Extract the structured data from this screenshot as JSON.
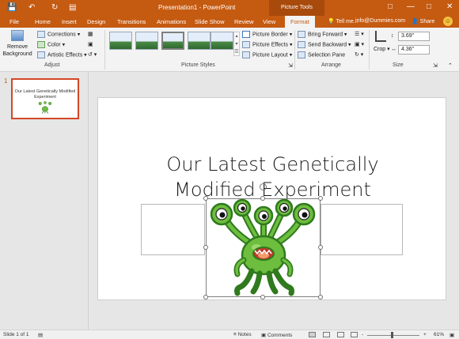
{
  "titlebar": {
    "window_title": "Presentation1 - PowerPoint",
    "context_tab_group": "Picture Tools",
    "quick_access": [
      "save-icon",
      "undo-icon",
      "redo-icon",
      "start-slideshow-icon"
    ],
    "window_controls": [
      "ribbon-display-options-icon",
      "minimize-icon",
      "maximize-icon",
      "close-icon"
    ]
  },
  "tabs": [
    "File",
    "Home",
    "Insert",
    "Design",
    "Transitions",
    "Animations",
    "Slide Show",
    "Review",
    "View",
    "Format"
  ],
  "active_tab": "Format",
  "tell_me": "Tell me...",
  "account": "info@Dummies.com",
  "share_label": "Share",
  "ribbon": {
    "adjust": {
      "remove_background": "Remove Background",
      "corrections": "Corrections",
      "color": "Color",
      "artistic_effects": "Artistic Effects",
      "group_label": "Adjust"
    },
    "picture_styles": {
      "picture_border": "Picture Border",
      "picture_effects": "Picture Effects",
      "picture_layout": "Picture Layout",
      "group_label": "Picture Styles"
    },
    "arrange": {
      "bring_forward": "Bring Forward",
      "send_backward": "Send Backward",
      "selection_pane": "Selection Pane",
      "group_label": "Arrange"
    },
    "size": {
      "crop": "Crop",
      "height": "3.69\"",
      "width": "4.36\"",
      "group_label": "Size"
    }
  },
  "thumbnail": {
    "number": "1",
    "title": "Our Latest Genetically Modified Experiment"
  },
  "slide": {
    "title_line1": "Our Latest Genetically",
    "title_line2": "Modified Experiment"
  },
  "statusbar": {
    "slide_info": "Slide 1 of 1",
    "notes": "Notes",
    "comments": "Comments",
    "zoom_minus": "-",
    "zoom_plus": "+",
    "zoom": "61%"
  },
  "colors": {
    "accent": "#c55a11",
    "monster_body": "#6dbd3e",
    "monster_dark": "#2f7a1d"
  }
}
